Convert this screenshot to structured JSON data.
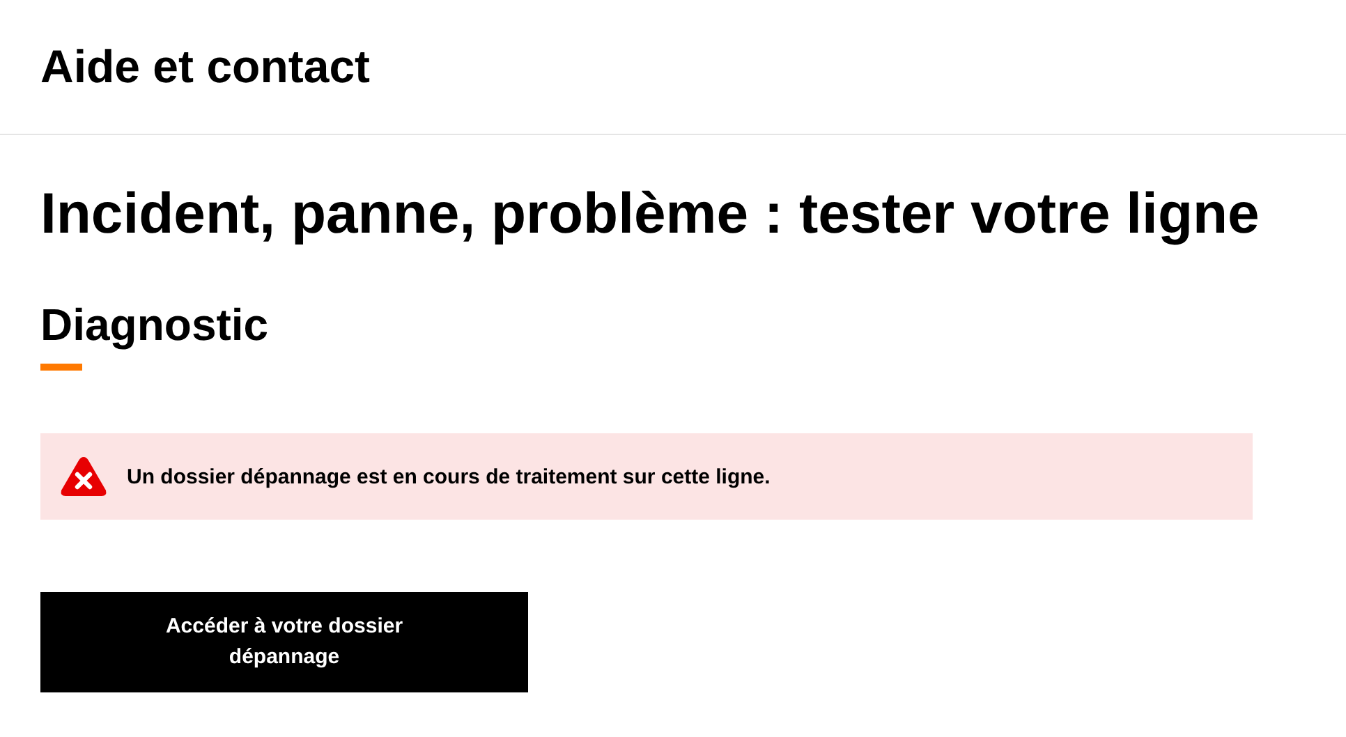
{
  "header": {
    "title": "Aide et contact"
  },
  "page_title": "Incident, panne, problème : tester votre ligne",
  "section_title": "Diagnostic",
  "alert": {
    "kind": "error",
    "message": "Un dossier dépannage est en cours de traitement sur cette ligne."
  },
  "button": {
    "label": "Accéder à votre dossier dépannage"
  }
}
